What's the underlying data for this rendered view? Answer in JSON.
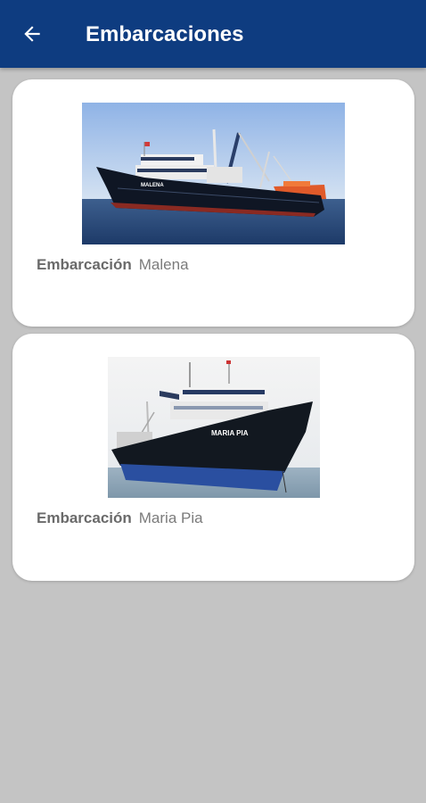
{
  "header": {
    "title": "Embarcaciones",
    "back_icon": "arrow-back-icon",
    "background_color": "#0e3c80"
  },
  "vessels": [
    {
      "label": "Embarcación",
      "name": "Malena",
      "image": "ship-photo-malena"
    },
    {
      "label": "Embarcación",
      "name": "Maria Pia",
      "image": "ship-photo-maria-pia"
    }
  ],
  "ship_markings": {
    "malena": "MALENA",
    "maria_pia": "MARIA PIA"
  }
}
